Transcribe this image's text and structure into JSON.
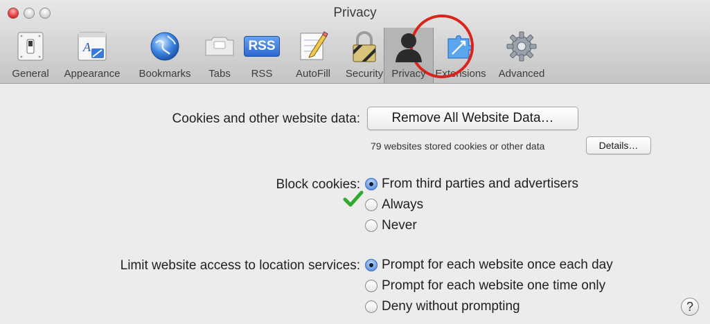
{
  "window": {
    "title": "Privacy"
  },
  "toolbar": {
    "items": [
      {
        "label": "General",
        "icon": "switch-icon"
      },
      {
        "label": "Appearance",
        "icon": "appearance-icon"
      },
      {
        "label": "Bookmarks",
        "icon": "globe-icon"
      },
      {
        "label": "Tabs",
        "icon": "tabs-icon"
      },
      {
        "label": "RSS",
        "icon": "rss-icon"
      },
      {
        "label": "AutoFill",
        "icon": "pencil-form-icon"
      },
      {
        "label": "Security",
        "icon": "lock-icon"
      },
      {
        "label": "Privacy",
        "icon": "person-silhouette-icon"
      },
      {
        "label": "Extensions",
        "icon": "puzzle-icon"
      },
      {
        "label": "Advanced",
        "icon": "gear-icon"
      }
    ],
    "selected": "Privacy",
    "rss_badge": "RSS"
  },
  "cookies": {
    "label": "Cookies and other website data:",
    "remove_button": "Remove All Website Data…",
    "stored_note": "79 websites stored cookies or other data",
    "details_button": "Details…"
  },
  "block_cookies": {
    "label": "Block cookies:",
    "options": [
      {
        "label": "From third parties and advertisers",
        "selected": true
      },
      {
        "label": "Always",
        "selected": false
      },
      {
        "label": "Never",
        "selected": false
      }
    ]
  },
  "location": {
    "label": "Limit website access to location services:",
    "options": [
      {
        "label": "Prompt for each website once each day",
        "selected": true
      },
      {
        "label": "Prompt for each website one time only",
        "selected": false
      },
      {
        "label": "Deny without prompting",
        "selected": false
      }
    ]
  },
  "help": {
    "label": "?"
  },
  "colors": {
    "annotation_circle": "#d9231b",
    "annotation_check": "#2eaa2e",
    "radio_selected": "#3c73cf"
  }
}
